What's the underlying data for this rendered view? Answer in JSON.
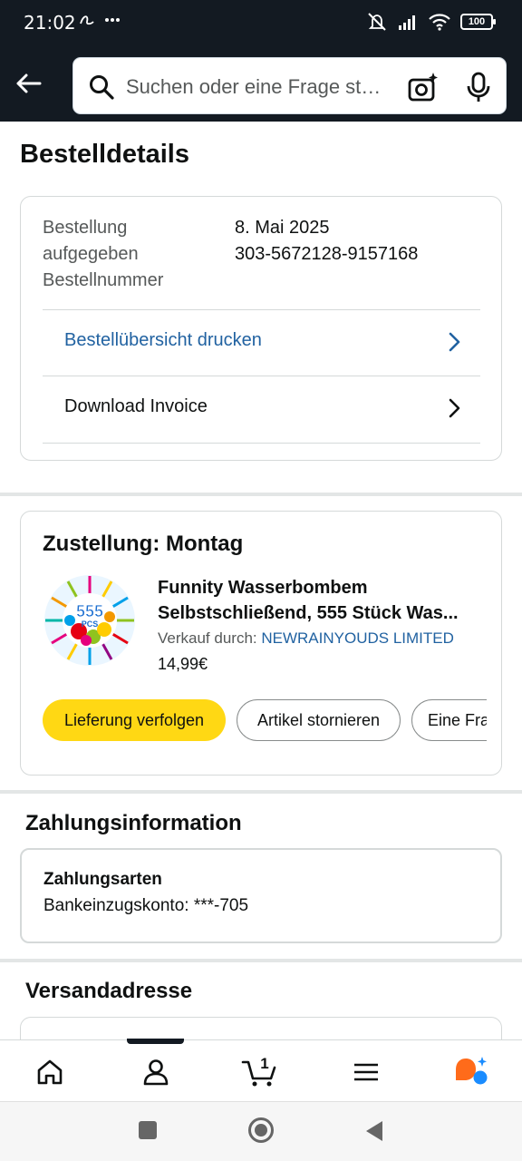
{
  "status_bar": {
    "time": "21:02",
    "battery": "100"
  },
  "search": {
    "placeholder": "Suchen oder eine Frage st…"
  },
  "page": {
    "title": "Bestelldetails"
  },
  "order": {
    "placed_label": "Bestellung aufgegeben",
    "placed_label_l1": "Bestellung",
    "placed_label_l2": "aufgegeben",
    "placed_value": "8. Mai 2025",
    "number_label": "Bestellnummer",
    "number_value": "303-5672128-9157168",
    "print_link": "Bestellübersicht drucken",
    "invoice_link": "Download Invoice"
  },
  "delivery": {
    "heading": "Zustellung: Montag",
    "product_name_l1": "Funnity Wasserbombem",
    "product_name_l2": "Selbstschließend, 555 Stück Was...",
    "product_image_badge": "555",
    "product_image_sub": "PCS",
    "seller_prefix": "Verkauf durch:",
    "seller_name": "NEWRAINYOUDS LIMITED",
    "price": "14,99€",
    "buttons": {
      "track": "Lieferung verfolgen",
      "cancel": "Artikel stornieren",
      "question": "Eine Fra"
    }
  },
  "payment": {
    "heading": "Zahlungsinformation",
    "method_label": "Zahlungsarten",
    "method_value": "Bankeinzugskonto: ***-705"
  },
  "shipping": {
    "heading": "Versandadresse"
  },
  "bottom_nav": {
    "cart_count": "1"
  },
  "colors": {
    "header_bg": "#131a22",
    "link_blue": "#2162a1",
    "primary_button": "#ffd814",
    "rufus_orange": "#ff6b1a",
    "rufus_blue": "#1a8cff"
  }
}
